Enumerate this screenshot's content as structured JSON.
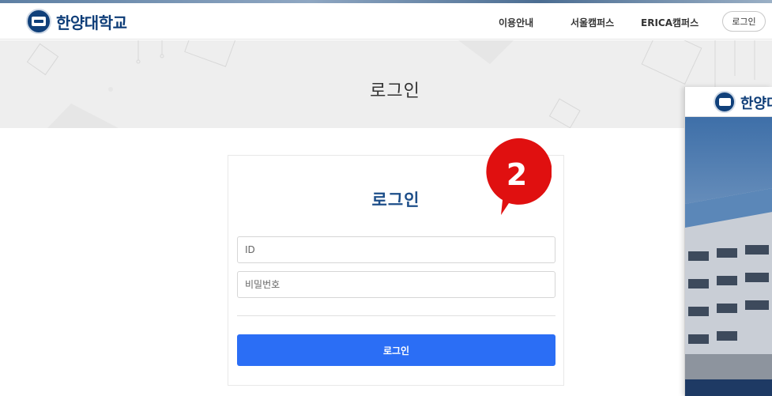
{
  "header": {
    "logo_text": "한양대학교",
    "nav": [
      "이용안내",
      "서울캠퍼스",
      "ERICA캠퍼스"
    ],
    "login_label": "로그인"
  },
  "banner": {
    "title": "로그인"
  },
  "login_form": {
    "title": "로그인",
    "id_placeholder": "ID",
    "password_placeholder": "비밀번호",
    "submit_label": "로그인"
  },
  "step_badge": {
    "number": "2",
    "color": "#e01010"
  },
  "overlay": {
    "logo_text": "한양대"
  },
  "colors": {
    "brand": "#0e3d78",
    "primary_button": "#2b6ef5",
    "banner_bg": "#eeeeee"
  }
}
